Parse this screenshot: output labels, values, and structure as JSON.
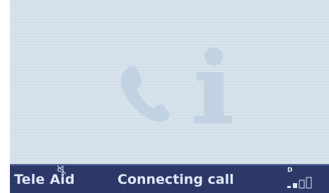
{
  "status_bar": {
    "app_label": "Tele Aid",
    "status_text": "Connecting call",
    "network_indicator": "D",
    "signal_strength": {
      "filled": 2,
      "total": 4
    },
    "muted": true
  },
  "display": {
    "watermark_icons": [
      "phone-handset-icon",
      "info-icon"
    ]
  },
  "colors": {
    "display_background": "#d6e2eb",
    "watermark": "#c1d3e2",
    "status_bar_background": "#2b3868",
    "status_bar_text": "#dfe6f6"
  }
}
